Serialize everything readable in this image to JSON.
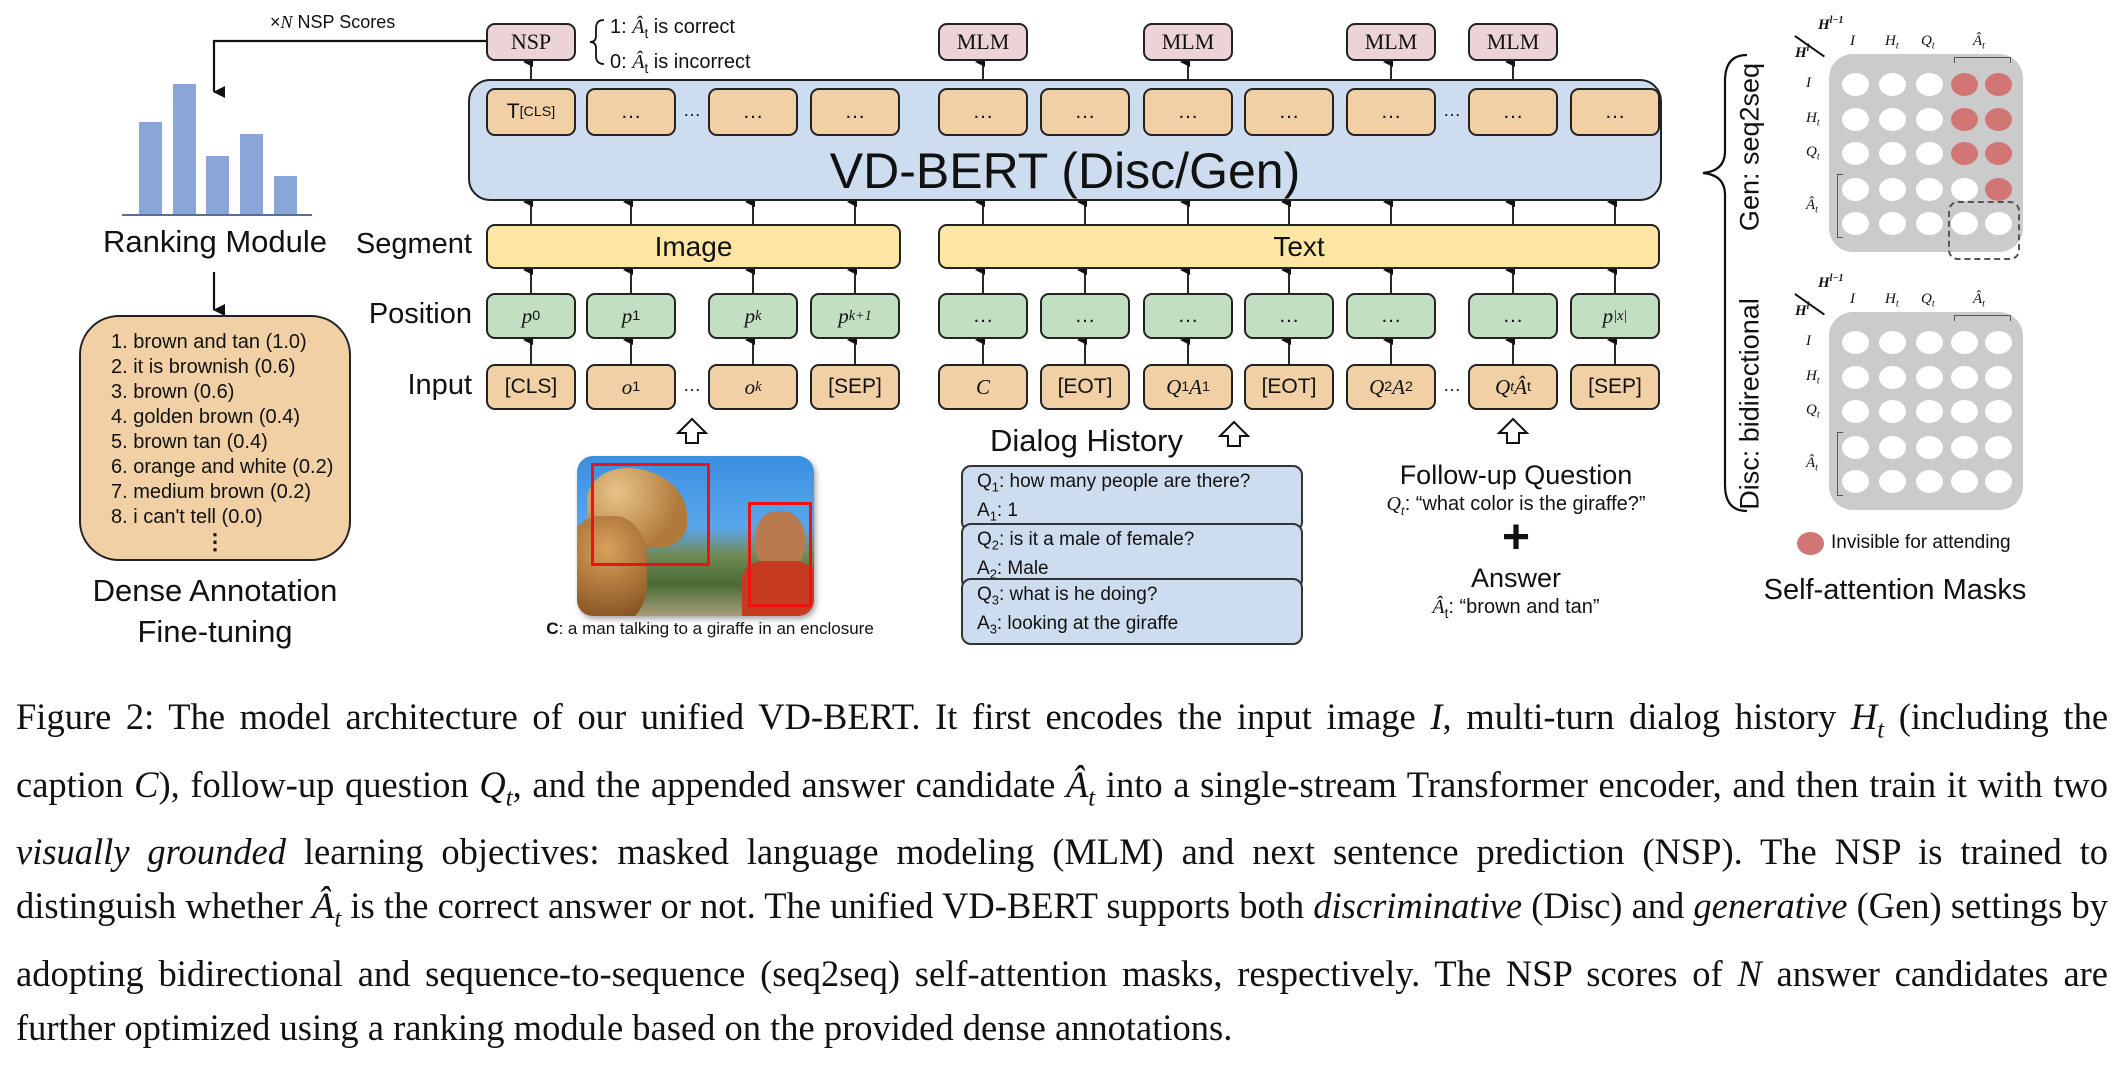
{
  "nsp": {
    "label": "NSP",
    "scores_label_prefix": "×",
    "scores_label_n": "N",
    "scores_label_rest": " NSP Scores",
    "outcomes": [
      {
        "value": "1: ",
        "answer": "Â",
        "sub": "t",
        "rest": " is correct"
      },
      {
        "value": "0: ",
        "answer": "Â",
        "sub": "t",
        "rest": " is incorrect"
      }
    ]
  },
  "mlm_label": "MLM",
  "model": {
    "title": "VD-BERT (Disc/Gen)"
  },
  "row_labels": {
    "segment": "Segment",
    "position": "Position",
    "input": "Input"
  },
  "segments": {
    "image": "Image",
    "text": "Text"
  },
  "ellipsis": "…",
  "top_tokens": [
    [
      {
        "t": "T"
      },
      {
        "t": "[CLS]",
        "sub": true
      }
    ],
    [
      {
        "t": "…"
      }
    ],
    [
      {
        "t": "…"
      }
    ],
    [
      {
        "t": "…"
      }
    ],
    [
      {
        "t": "…"
      }
    ],
    [
      {
        "t": "…"
      }
    ],
    [
      {
        "t": "…"
      }
    ],
    [
      {
        "t": "…"
      }
    ],
    [
      {
        "t": "…"
      }
    ],
    [
      {
        "t": "…"
      }
    ],
    [
      {
        "t": "…"
      }
    ]
  ],
  "position_tokens": [
    [
      {
        "t": "p",
        "i": true
      },
      {
        "t": "0",
        "sub": true
      }
    ],
    [
      {
        "t": "p",
        "i": true
      },
      {
        "t": "1",
        "sub": true
      }
    ],
    [
      {
        "t": "p",
        "i": true
      },
      {
        "t": "k",
        "sub": true,
        "i": true
      }
    ],
    [
      {
        "t": "p",
        "i": true
      },
      {
        "t": "k+1",
        "sub": true,
        "i": true
      }
    ],
    [
      {
        "t": "…"
      }
    ],
    [
      {
        "t": "…"
      }
    ],
    [
      {
        "t": "…"
      }
    ],
    [
      {
        "t": "…"
      }
    ],
    [
      {
        "t": "…"
      }
    ],
    [
      {
        "t": "…"
      }
    ],
    [
      {
        "t": "p",
        "i": true
      },
      {
        "t": "|x|",
        "sub": true,
        "i": true
      }
    ]
  ],
  "input_tokens": [
    [
      {
        "t": "[CLS]"
      }
    ],
    [
      {
        "t": "o",
        "i": true
      },
      {
        "t": "1",
        "sub": true
      }
    ],
    [
      {
        "t": "o",
        "i": true
      },
      {
        "t": "k",
        "sub": true,
        "i": true
      }
    ],
    [
      {
        "t": "[SEP]"
      }
    ],
    [
      {
        "t": "C",
        "i": true
      }
    ],
    [
      {
        "t": "[EOT]"
      }
    ],
    [
      {
        "t": "Q",
        "i": true
      },
      {
        "t": "1",
        "sub": true
      },
      {
        "t": "A",
        "i": true
      },
      {
        "t": "1",
        "sub": true
      }
    ],
    [
      {
        "t": "[EOT]"
      }
    ],
    [
      {
        "t": "Q",
        "i": true
      },
      {
        "t": "2",
        "sub": true
      },
      {
        "t": "A",
        "i": true
      },
      {
        "t": "2",
        "sub": true
      }
    ],
    [
      {
        "t": "Q",
        "i": true
      },
      {
        "t": "t",
        "sub": true,
        "i": true
      },
      {
        "t": "Â",
        "i": true
      },
      {
        "t": "t",
        "sub": true
      }
    ],
    [
      {
        "t": "[SEP]"
      }
    ]
  ],
  "ranking": {
    "title": "Ranking Module",
    "bar_values": [
      0.6,
      0.85,
      0.38,
      0.52,
      0.25
    ],
    "bar_color": "#8aa5d8"
  },
  "dense": {
    "items": [
      "1. brown and tan (1.0)",
      "2. it is brownish (0.6)",
      "3. brown (0.6)",
      "4. golden brown (0.4)",
      "5. brown tan (0.4)",
      "6. orange and white (0.2)",
      "7. medium brown (0.2)",
      "8. i can't tell (0.0)"
    ],
    "more": "⋮",
    "title_line1": "Dense Annotation",
    "title_line2": "Fine-tuning"
  },
  "image_caption": {
    "label": "C",
    "text": ": a man talking to a giraffe in an enclosure"
  },
  "dialog": {
    "title": "Dialog History",
    "turns": [
      {
        "q_num": "1",
        "q": ": how many people are there?",
        "a_num": "1",
        "a": ": 1"
      },
      {
        "q_num": "2",
        "q": ": is it a male of female?",
        "a_num": "2",
        "a": ": Male"
      },
      {
        "q_num": "3",
        "q": ": what is he doing?",
        "a_num": "3",
        "a": ": looking at the giraffe"
      }
    ]
  },
  "followup": {
    "title": "Follow-up Question",
    "q_symbol": "Q",
    "q_sub": "t",
    "q_text": ": “what color is the giraffe?”",
    "plus": "+",
    "answer_title": "Answer",
    "a_symbol": "Â",
    "a_sub": "t",
    "a_text": ": “brown and tan”"
  },
  "masks": {
    "gen_label": "Gen: seq2seq",
    "disc_label": "Disc: bidirectional",
    "corner_top": "H",
    "corner_top_sup": "l−1",
    "corner_bottom": "H",
    "corner_bottom_sup": "l",
    "columns": [
      "I",
      "H",
      "Q",
      "Â"
    ],
    "column_subs": [
      "",
      "t",
      "t",
      "t"
    ],
    "rows": [
      "I",
      "H",
      "Q",
      "Â"
    ],
    "row_subs": [
      "",
      "t",
      "t",
      "t"
    ],
    "gen_invisible": [
      [
        0,
        0,
        0,
        1,
        1
      ],
      [
        0,
        0,
        0,
        1,
        1
      ],
      [
        0,
        0,
        0,
        1,
        1
      ],
      [
        0,
        0,
        0,
        0,
        1
      ],
      [
        0,
        0,
        0,
        0,
        0
      ]
    ],
    "disc_invisible": [
      [
        0,
        0,
        0,
        0,
        0
      ],
      [
        0,
        0,
        0,
        0,
        0
      ],
      [
        0,
        0,
        0,
        0,
        0
      ],
      [
        0,
        0,
        0,
        0,
        0
      ],
      [
        0,
        0,
        0,
        0,
        0
      ]
    ],
    "legend": "Invisible for attending",
    "invisible_color": "#d27575",
    "title": "Self-attention Masks"
  },
  "caption": [
    {
      "t": "Figure 2: The model architecture of our unified VD-BERT. It first encodes the input image "
    },
    {
      "t": "I",
      "em": true
    },
    {
      "t": ", multi-turn dialog history "
    },
    {
      "t": "H",
      "em": true
    },
    {
      "t": "t",
      "em": true,
      "sub": true
    },
    {
      "t": " (including the caption "
    },
    {
      "t": "C",
      "em": true
    },
    {
      "t": "), follow-up question "
    },
    {
      "t": "Q",
      "em": true
    },
    {
      "t": "t",
      "em": true,
      "sub": true
    },
    {
      "t": ", and the appended answer candidate "
    },
    {
      "t": "Â",
      "em": true
    },
    {
      "t": "t",
      "em": true,
      "sub": true
    },
    {
      "t": " into a single-​stream Transformer encoder, and then train it with two "
    },
    {
      "t": "visually grounded",
      "em": true
    },
    {
      "t": " learning objectives: masked language modeling (MLM) and next sentence prediction (NSP). The NSP is trained to distinguish whether "
    },
    {
      "t": "Â",
      "em": true
    },
    {
      "t": "t",
      "em": true,
      "sub": true
    },
    {
      "t": " is the cor­rect answer or not. The unified VD-BERT supports both "
    },
    {
      "t": "discriminative",
      "em": true
    },
    {
      "t": " (Disc) and "
    },
    {
      "t": "generative",
      "em": true
    },
    {
      "t": " (Gen) settings by adopting bidirectional and sequence-to-sequence (seq2seq) self-attention masks, respectively. The NSP scores of "
    },
    {
      "t": "N",
      "em": true
    },
    {
      "t": " answer candidates are further optimized using a ranking module based on the provided dense annotations."
    }
  ]
}
